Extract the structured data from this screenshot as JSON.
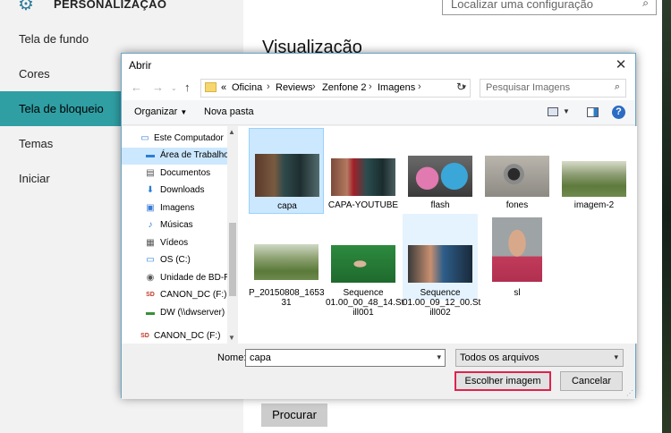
{
  "settings": {
    "title": "PERSONALIZAÇÃO",
    "search_placeholder": "Localizar uma configuração",
    "nav": [
      {
        "label": "Tela de fundo"
      },
      {
        "label": "Cores"
      },
      {
        "label": "Tela de bloqueio",
        "active": true
      },
      {
        "label": "Temas"
      },
      {
        "label": "Iniciar"
      }
    ],
    "section_title": "Visualização",
    "browse_button": "Procurar"
  },
  "dialog": {
    "title": "Abrir",
    "breadcrumb_prefix": "«",
    "breadcrumb": [
      "Oficina",
      "Reviews",
      "Zenfone 2",
      "Imagens"
    ],
    "search_placeholder": "Pesquisar Imagens",
    "toolbar": {
      "organize": "Organizar",
      "new_folder": "Nova pasta"
    },
    "tree": [
      {
        "label": "Este Computador",
        "icon": "computer-icon"
      },
      {
        "label": "Área de Trabalho",
        "icon": "desktop-icon",
        "selected": true
      },
      {
        "label": "Documentos",
        "icon": "documents-icon"
      },
      {
        "label": "Downloads",
        "icon": "downloads-icon"
      },
      {
        "label": "Imagens",
        "icon": "pictures-icon"
      },
      {
        "label": "Músicas",
        "icon": "music-icon"
      },
      {
        "label": "Vídeos",
        "icon": "videos-icon"
      },
      {
        "label": "OS (C:)",
        "icon": "drive-icon"
      },
      {
        "label": "Unidade de BD-R",
        "icon": "bd-drive-icon"
      },
      {
        "label": "CANON_DC (F:)",
        "icon": "sd-card-icon"
      },
      {
        "label": "DW (\\\\dwserver)",
        "icon": "network-drive-icon"
      },
      {
        "label": "CANON_DC (F:)",
        "icon": "sd-card-icon"
      }
    ],
    "files": [
      {
        "name": "capa",
        "selected": true
      },
      {
        "name": "CAPA-YOUTUBE"
      },
      {
        "name": "flash"
      },
      {
        "name": "fones"
      },
      {
        "name": "imagem-2"
      },
      {
        "name": "P_20150808_165331"
      },
      {
        "name": "Sequence 01.00_00_48_14.Still001"
      },
      {
        "name": "Sequence 01.00_09_12_00.Still002",
        "hover": true
      },
      {
        "name": "sl"
      }
    ],
    "file_labels": {
      "f0": "capa",
      "f1": "CAPA-YOUTUBE",
      "f2": "flash",
      "f3": "fones",
      "f4": "imagem-2",
      "f5a": "P_20150808_1653",
      "f5b": "31",
      "f6a": "Sequence",
      "f6b": "01.00_00_48_14.St",
      "f6c": "ill001",
      "f7a": "Sequence",
      "f7b": "01.00_09_12_00.St",
      "f7c": "ill002",
      "f8": "sl"
    },
    "filename_label": "Nome:",
    "filename_value": "capa",
    "filter_value": "Todos os arquivos",
    "ok_button": "Escolher imagem",
    "cancel_button": "Cancelar"
  },
  "colors": {
    "accent": "#2f9fa4",
    "selection": "#cce8ff",
    "highlight_border": "#e0224d"
  }
}
